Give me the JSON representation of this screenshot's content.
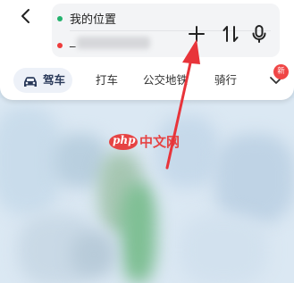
{
  "route": {
    "start_label": "我的位置",
    "end_label": "_"
  },
  "modes": [
    {
      "label": "驾车",
      "active": true
    },
    {
      "label": "打车",
      "active": false
    },
    {
      "label": "公交地铁",
      "active": false
    },
    {
      "label": "骑行",
      "active": false
    }
  ],
  "more_badge": "新",
  "watermark": {
    "logo": "php",
    "text": "中文网"
  },
  "icons": {
    "back": "chevron-left-icon",
    "add": "plus-icon",
    "swap": "swap-vertical-icon",
    "voice": "microphone-icon",
    "car": "car-icon",
    "more": "chevron-down-icon"
  },
  "colors": {
    "start_dot": "#23b26d",
    "end_dot": "#ee3b3b",
    "annotation_arrow": "#e8343a",
    "badge": "#f04646"
  }
}
